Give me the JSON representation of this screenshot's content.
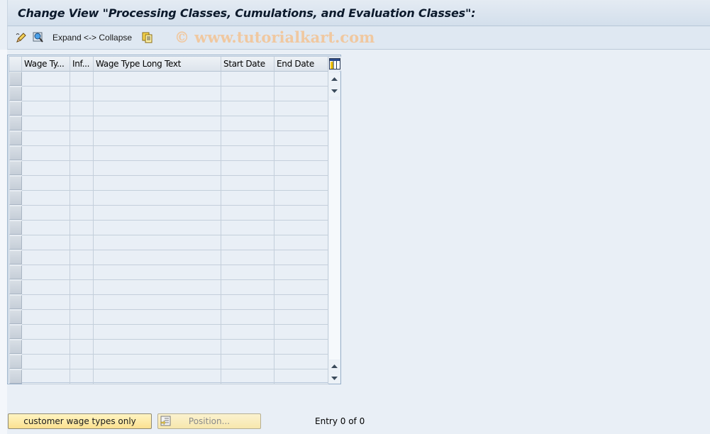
{
  "window": {
    "title": "Change View \"Processing Classes, Cumulations, and Evaluation Classes\":"
  },
  "toolbar": {
    "items": [
      {
        "icon": "edit-pencil-icon"
      },
      {
        "icon": "display-details-icon"
      },
      {
        "label": "Expand <-> Collapse"
      },
      {
        "icon": "copy-icon"
      }
    ],
    "expand_collapse_label": "Expand <-> Collapse",
    "watermark": "© www.tutorialkart.com"
  },
  "table": {
    "columns": [
      {
        "label": "Wage Ty..."
      },
      {
        "label": "Inf..."
      },
      {
        "label": "Wage Type Long Text"
      },
      {
        "label": "Start Date"
      },
      {
        "label": "End Date"
      }
    ],
    "visible_rows": 21,
    "rows": [],
    "column_settings_icon": "table-settings-icon"
  },
  "footer": {
    "customer_button_label": "customer wage types only",
    "position_button_label": "Position...",
    "entry_text": "Entry 0 of 0"
  },
  "colors": {
    "background": "#e9eff6",
    "button_yellow": "#fbe190",
    "title_text": "#0c1a2c"
  }
}
